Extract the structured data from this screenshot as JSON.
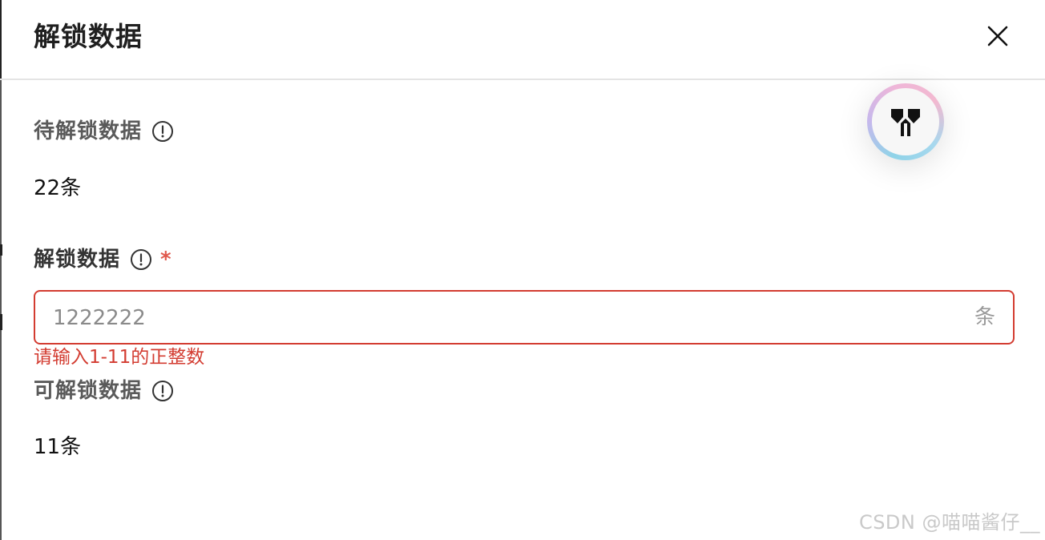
{
  "dialog": {
    "title": "解锁数据",
    "close_icon": "close-icon"
  },
  "pending": {
    "label": "待解锁数据",
    "info_icon": "info-circle-icon",
    "value": "22条"
  },
  "unlock": {
    "label": "解锁数据",
    "info_icon": "info-circle-icon",
    "required_mark": "*",
    "input_value": "1222222",
    "suffix": "条",
    "error": "请输入1-11的正整数",
    "border_color": "#d33c31"
  },
  "available": {
    "label": "可解锁数据",
    "info_icon": "info-circle-icon",
    "value": "11条"
  },
  "floating_assistant": {
    "icon": "assistant-logo-icon"
  },
  "watermark": "CSDN @喵喵酱仔__"
}
